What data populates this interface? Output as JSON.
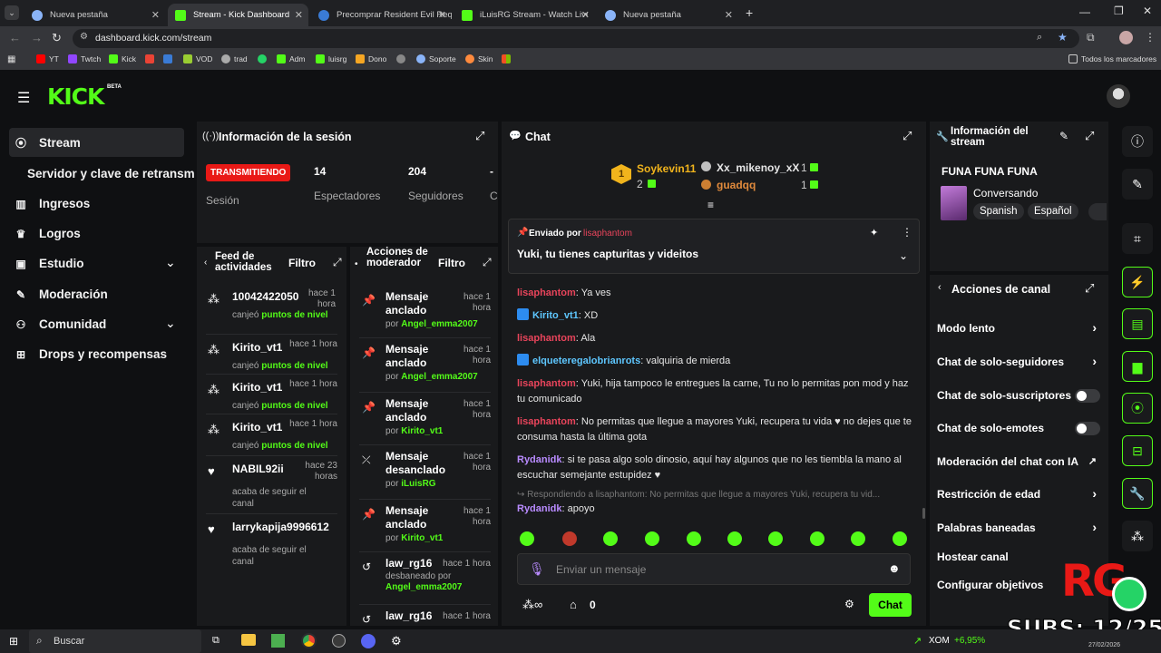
{
  "browser": {
    "tabs": [
      {
        "title": "Nueva pestaña",
        "color": "#8ab4f8"
      },
      {
        "title": "Stream - Kick Dashboard",
        "color": "#53fc18"
      },
      {
        "title": "Precomprar Resident Evil Requ",
        "color": "#3a7bd5"
      },
      {
        "title": "iLuisRG Stream - Watch Live on",
        "color": "#53fc18"
      },
      {
        "title": "Nueva pestaña",
        "color": "#8ab4f8"
      }
    ],
    "url": "dashboard.kick.com/stream",
    "bookmarks": [
      "YT",
      "Twtch",
      "Kick",
      "Adm",
      "luisrg",
      "Dono",
      "Soporte",
      "Skin",
      "VOD",
      "trad"
    ],
    "all_bookmarks": "Todos los marcadores"
  },
  "brand": {
    "logo": "KICK",
    "beta": "BETA"
  },
  "sidebar": {
    "items": [
      {
        "label": "Stream",
        "icon": "broadcast-icon"
      },
      {
        "label": "Servidor y clave de retransm",
        "icon": ""
      },
      {
        "label": "Ingresos",
        "icon": "chart-icon"
      },
      {
        "label": "Logros",
        "icon": "trophy-icon"
      },
      {
        "label": "Estudio",
        "icon": "studio-icon"
      },
      {
        "label": "Moderación",
        "icon": "wrench-icon"
      },
      {
        "label": "Comunidad",
        "icon": "community-icon"
      },
      {
        "label": "Drops y recompensas",
        "icon": "gift-icon"
      }
    ]
  },
  "session": {
    "title": "Información de la sesión",
    "status": "TRANSMITIENDO",
    "session_label": "Sesión",
    "viewers": "14",
    "viewers_label": "Espectadores",
    "followers": "204",
    "followers_label": "Seguidores",
    "extra_value": "-",
    "extra_label": "Cu"
  },
  "feed": {
    "title": "Feed de actividades",
    "filter": "Filtro",
    "items": [
      {
        "user": "10042422050",
        "time": "hace 1 hora",
        "action": "canjeó",
        "detail": "puntos de nivel"
      },
      {
        "user": "Kirito_vt1",
        "time": "hace 1 hora",
        "action": "canjeó",
        "detail": "puntos de nivel"
      },
      {
        "user": "Kirito_vt1",
        "time": "hace 1 hora",
        "action": "canjeó",
        "detail": "puntos de nivel"
      },
      {
        "user": "Kirito_vt1",
        "time": "hace 1 hora",
        "action": "canjeó",
        "detail": "puntos de nivel"
      },
      {
        "user": "NABIL92ii",
        "time": "hace 23 horas",
        "action": "acaba de seguir el canal",
        "detail": ""
      },
      {
        "user": "larrykapija9996612",
        "time": "",
        "action": "acaba de seguir el canal",
        "detail": ""
      }
    ]
  },
  "modactions": {
    "title": "Acciones de moderador",
    "filter": "Filtro",
    "items": [
      {
        "action": "Mensaje anclado",
        "by": "por",
        "user": "Angel_emma2007",
        "time": "hace 1 hora"
      },
      {
        "action": "Mensaje anclado",
        "by": "por",
        "user": "Angel_emma2007",
        "time": "hace 1 hora"
      },
      {
        "action": "Mensaje anclado",
        "by": "por",
        "user": "Kirito_vt1",
        "time": "hace 1 hora"
      },
      {
        "action": "Mensaje desanclado",
        "by": "por",
        "user": "iLuisRG",
        "time": "hace 1 hora"
      },
      {
        "action": "Mensaje anclado",
        "by": "por",
        "user": "Kirito_vt1",
        "time": "hace 1 hora"
      },
      {
        "action": "law_rg16",
        "by": "desbaneado por",
        "user": "Angel_emma2007",
        "time": "hace 1 hora"
      },
      {
        "action": "law_rg16",
        "by": "",
        "user": "",
        "time": "hace 1 hora"
      }
    ]
  },
  "chat": {
    "title": "Chat",
    "leaders": [
      {
        "name": "Soykevin11",
        "count": "2"
      },
      {
        "name": "Xx_mikenoy_xX",
        "count": "1"
      },
      {
        "name": "guadqq",
        "count": "1"
      }
    ],
    "pinned": {
      "by_label": "Enviado por",
      "by_user": "lisaphantom",
      "text": "Yuki, tu tienes capturitas y videitos"
    },
    "messages": [
      {
        "user": "lisaphantom",
        "color": "red",
        "text": "Ya ves"
      },
      {
        "user": "Kirito_vt1",
        "color": "blue",
        "text": "XD"
      },
      {
        "user": "lisaphantom",
        "color": "red",
        "text": "Ala"
      },
      {
        "user": "elqueteregalobrianrots",
        "color": "blue",
        "text": "valquiria de mierda"
      },
      {
        "user": "lisaphantom",
        "color": "red",
        "text": "Yuki, hija tampoco le entregues la carne, Tu no lo permitas pon mod y haz tu comunicado"
      },
      {
        "user": "lisaphantom",
        "color": "red",
        "text": "No permitas que llegue a mayores Yuki, recupera tu vida ♥ no dejes que te consuma hasta la última gota"
      },
      {
        "user": "Rydanidk",
        "color": "purple",
        "text": "si te pasa algo solo dinosio, aquí hay algunos que no les tiembla la mano al escuchar semejante estupidez ♥"
      },
      {
        "user": "Rydanidk",
        "color": "purple",
        "text": "apoyo"
      }
    ],
    "reply_hint": "Respondiendo a lisaphantom: No permitas que llegue a mayores Yuki, recupera tu vid...",
    "input_placeholder": "Enviar un mensaje",
    "points": "0",
    "send": "Chat"
  },
  "stream_info": {
    "title": "Información del stream",
    "stream_title": "FUNA FUNA FUNA",
    "category": "Conversando",
    "tags": [
      "Spanish",
      "Español"
    ]
  },
  "channel_actions": {
    "title": "Acciones de canal",
    "rows": [
      {
        "label": "Modo lento",
        "kind": "chevron"
      },
      {
        "label": "Chat de solo-seguidores",
        "kind": "chevron"
      },
      {
        "label": "Chat de solo-suscriptores",
        "kind": "toggle"
      },
      {
        "label": "Chat de solo-emotes",
        "kind": "toggle"
      },
      {
        "label": "Moderación del chat con IA",
        "kind": "external"
      },
      {
        "label": "Restricción de edad",
        "kind": "chevron"
      },
      {
        "label": "Palabras baneadas",
        "kind": "chevron"
      },
      {
        "label": "Hostear canal",
        "kind": "none"
      },
      {
        "label": "Configurar objetivos",
        "kind": "none"
      }
    ]
  },
  "overlay": {
    "logo": "RG",
    "subs": "SUBS: 12/25"
  },
  "taskbar": {
    "search": "Buscar",
    "ticker": "XOM",
    "change": "+6,95%",
    "date": "27/02/2026"
  },
  "colors": {
    "accent": "#53fc18",
    "live": "#e91916"
  }
}
